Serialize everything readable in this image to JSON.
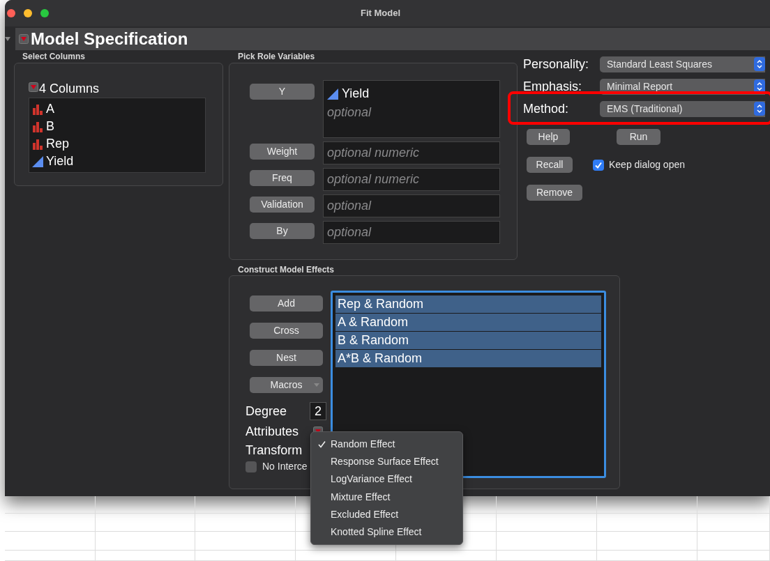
{
  "window": {
    "title": "Fit Model"
  },
  "section": {
    "title": "Model Specification",
    "expanded": true
  },
  "select_columns": {
    "label": "Select Columns",
    "header": "4 Columns",
    "columns": [
      {
        "name": "A",
        "kind": "nominal"
      },
      {
        "name": "B",
        "kind": "nominal"
      },
      {
        "name": "Rep",
        "kind": "nominal"
      },
      {
        "name": "Yield",
        "kind": "continuous"
      }
    ]
  },
  "pick_roles": {
    "label": "Pick Role Variables",
    "roles": [
      {
        "button": "Y",
        "values": [
          {
            "name": "Yield",
            "kind": "continuous"
          }
        ],
        "placeholder": "optional"
      },
      {
        "button": "Weight",
        "placeholder": "optional numeric"
      },
      {
        "button": "Freq",
        "placeholder": "optional numeric"
      },
      {
        "button": "Validation",
        "placeholder": "optional"
      },
      {
        "button": "By",
        "placeholder": "optional"
      }
    ]
  },
  "options": [
    {
      "label": "Personality:",
      "value": "Standard Least Squares",
      "highlighted": false
    },
    {
      "label": "Emphasis:",
      "value": "Minimal Report",
      "highlighted": false
    },
    {
      "label": "Method:",
      "value": "EMS (Traditional)",
      "highlighted": true
    }
  ],
  "actions": {
    "help": "Help",
    "run": "Run",
    "recall": "Recall",
    "remove": "Remove",
    "keep_open": {
      "label": "Keep dialog open",
      "checked": true
    }
  },
  "construct": {
    "label": "Construct Model Effects",
    "buttons": [
      {
        "label": "Add",
        "kind": "plain"
      },
      {
        "label": "Cross",
        "kind": "plain"
      },
      {
        "label": "Nest",
        "kind": "plain"
      },
      {
        "label": "Macros",
        "kind": "menu"
      }
    ],
    "degree": {
      "label": "Degree",
      "value": "2"
    },
    "attributes": "Attributes",
    "transform": "Transform",
    "no_intercept": {
      "label": "No Interce",
      "checked": false
    },
    "effects": [
      {
        "label": "Rep & Random",
        "selected": true
      },
      {
        "label": "A & Random",
        "selected": true
      },
      {
        "label": "B & Random",
        "selected": true
      },
      {
        "label": "A*B & Random",
        "selected": true
      }
    ]
  },
  "attributes_menu": [
    {
      "label": "Random Effect",
      "checked": true
    },
    {
      "label": "Response Surface Effect",
      "checked": false
    },
    {
      "label": "LogVariance Effect",
      "checked": false
    },
    {
      "label": "Mixture Effect",
      "checked": false
    },
    {
      "label": "Excluded Effect",
      "checked": false
    },
    {
      "label": "Knotted Spline Effect",
      "checked": false
    }
  ]
}
